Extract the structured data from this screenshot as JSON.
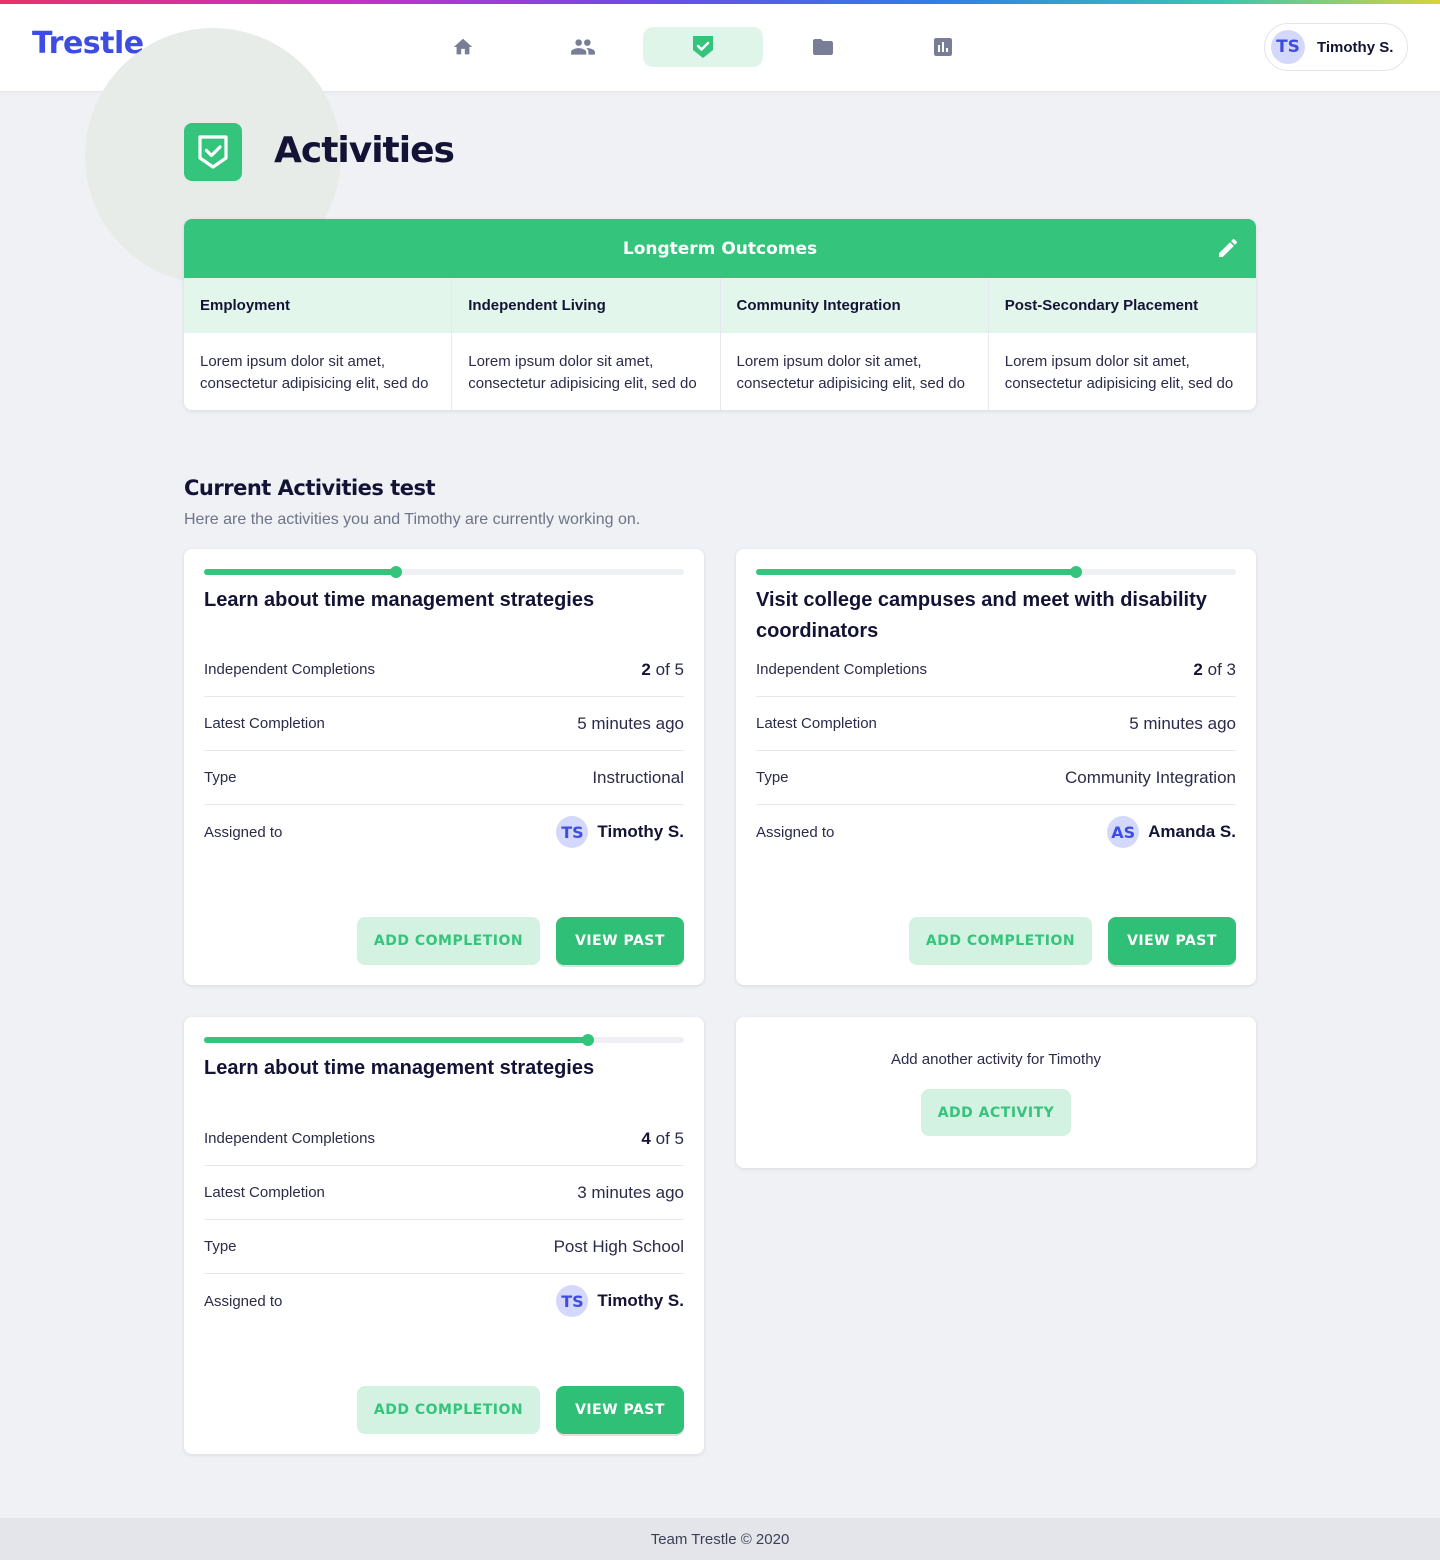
{
  "app": {
    "name": "Trestle"
  },
  "nav": {
    "items": [
      {
        "name": "home-icon",
        "active": false
      },
      {
        "name": "people-icon",
        "active": false
      },
      {
        "name": "activities-shield-icon",
        "active": true
      },
      {
        "name": "folder-icon",
        "active": false
      },
      {
        "name": "chart-icon",
        "active": false
      }
    ]
  },
  "user": {
    "initials": "TS",
    "name": "Timothy S."
  },
  "page": {
    "title": "Activities",
    "icon": "shield-check-icon"
  },
  "outcomes": {
    "title": "Longterm Outcomes",
    "columns": [
      {
        "header": "Employment",
        "text": "Lorem ipsum dolor sit amet, consectetur adipisicing elit, sed do"
      },
      {
        "header": "Independent Living",
        "text": "Lorem ipsum dolor sit amet, consectetur adipisicing elit, sed do"
      },
      {
        "header": "Community Integration",
        "text": "Lorem ipsum dolor sit amet, consectetur adipisicing elit, sed do"
      },
      {
        "header": "Post-Secondary Placement",
        "text": "Lorem ipsum dolor sit amet, consectetur adipisicing elit, sed do"
      }
    ]
  },
  "section": {
    "title": "Current Activities test",
    "subtitle": "Here are the activities you and Timothy are currently working on."
  },
  "labels": {
    "completions": "Independent Completions",
    "latest": "Latest Completion",
    "type": "Type",
    "assigned": "Assigned to",
    "of": "of",
    "add_completion": "ADD COMPLETION",
    "view_past": "VIEW PAST"
  },
  "activities": [
    {
      "title": "Learn about time management strategies",
      "progress": 0.4,
      "done": "2",
      "total": "5",
      "latest": "5 minutes ago",
      "type": "Instructional",
      "assignee_initials": "TS",
      "assignee_name": "Timothy S."
    },
    {
      "title": "Visit college campuses and meet with disability coordinators",
      "progress": 0.667,
      "done": "2",
      "total": "3",
      "latest": "5 minutes ago",
      "type": "Community Integration",
      "assignee_initials": "AS",
      "assignee_name": "Amanda S."
    },
    {
      "title": "Learn about time management strategies",
      "progress": 0.8,
      "done": "4",
      "total": "5",
      "latest": "3 minutes ago",
      "type": "Post High School",
      "assignee_initials": "TS",
      "assignee_name": "Timothy S."
    }
  ],
  "add_card": {
    "text": "Add another activity for Timothy",
    "button": "ADD ACTIVITY"
  },
  "footer": {
    "text": "Team Trestle © 2020"
  },
  "colors": {
    "brand": "#3d4de3",
    "accent": "#34c47c",
    "accent_light": "#d3f2e2",
    "background": "#f0f1f5"
  }
}
